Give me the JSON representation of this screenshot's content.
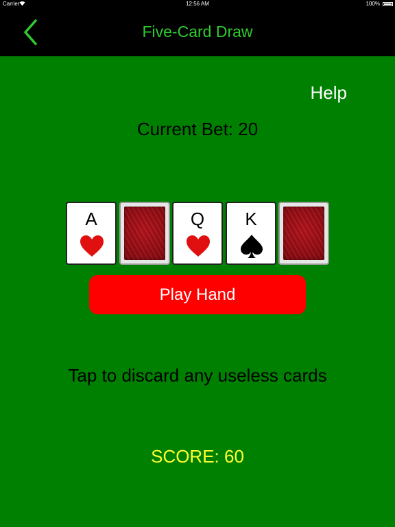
{
  "status_bar": {
    "carrier": "Carrier",
    "time": "12:56 AM",
    "battery": "100%"
  },
  "nav": {
    "title": "Five-Card Draw",
    "back_icon": "chevron-left-icon",
    "accent": "#2ecc2e"
  },
  "help_label": "Help",
  "current_bet": "Current Bet: 20",
  "cards": [
    {
      "rank": "A",
      "suit": "hearts",
      "face_up": true
    },
    {
      "rank": "",
      "suit": "",
      "face_up": false
    },
    {
      "rank": "Q",
      "suit": "hearts",
      "face_up": true
    },
    {
      "rank": "K",
      "suit": "spades",
      "face_up": true
    },
    {
      "rank": "",
      "suit": "",
      "face_up": false
    }
  ],
  "play_button": {
    "label": "Play Hand",
    "color": "#ff0000"
  },
  "instruction": "Tap to discard any useless cards",
  "score": "SCORE: 60",
  "colors": {
    "background": "#008000",
    "score": "#ffff33",
    "heart": "#e01010",
    "spade": "#000000"
  }
}
